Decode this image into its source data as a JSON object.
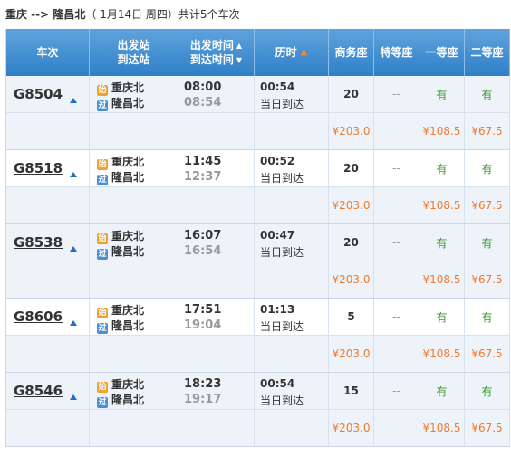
{
  "title": {
    "route": "重庆 --> 隆昌北",
    "date": "（ 1月14日  周四）",
    "count": "共计5个车次"
  },
  "headers": {
    "train": "车次",
    "station_top": "出发站",
    "station_bottom": "到达站",
    "time_top": "出发时间",
    "time_bottom": "到达时间",
    "duration": "历时",
    "business": "商务座",
    "special": "特等座",
    "first": "一等座",
    "second": "二等座"
  },
  "badges": {
    "start": "始",
    "pass": "过"
  },
  "trains": [
    {
      "no": "G8504",
      "from": "重庆北",
      "to": "隆昌北",
      "dep": "08:00",
      "arr": "08:54",
      "dur": "00:54",
      "arrive_day": "当日到达",
      "business": "20",
      "special": "--",
      "first": "有",
      "second": "有",
      "price_business": "¥203.0",
      "price_first": "¥108.5",
      "price_second": "¥67.5"
    },
    {
      "no": "G8518",
      "from": "重庆北",
      "to": "隆昌北",
      "dep": "11:45",
      "arr": "12:37",
      "dur": "00:52",
      "arrive_day": "当日到达",
      "business": "20",
      "special": "--",
      "first": "有",
      "second": "有",
      "price_business": "¥203.0",
      "price_first": "¥108.5",
      "price_second": "¥67.5"
    },
    {
      "no": "G8538",
      "from": "重庆北",
      "to": "隆昌北",
      "dep": "16:07",
      "arr": "16:54",
      "dur": "00:47",
      "arrive_day": "当日到达",
      "business": "20",
      "special": "--",
      "first": "有",
      "second": "有",
      "price_business": "¥203.0",
      "price_first": "¥108.5",
      "price_second": "¥67.5"
    },
    {
      "no": "G8606",
      "from": "重庆北",
      "to": "隆昌北",
      "dep": "17:51",
      "arr": "19:04",
      "dur": "01:13",
      "arrive_day": "当日到达",
      "business": "5",
      "special": "--",
      "first": "有",
      "second": "有",
      "price_business": "¥203.0",
      "price_first": "¥108.5",
      "price_second": "¥67.5"
    },
    {
      "no": "G8546",
      "from": "重庆北",
      "to": "隆昌北",
      "dep": "18:23",
      "arr": "19:17",
      "dur": "00:54",
      "arrive_day": "当日到达",
      "business": "15",
      "special": "--",
      "first": "有",
      "second": "有",
      "price_business": "¥203.0",
      "price_first": "¥108.5",
      "price_second": "¥67.5"
    }
  ],
  "colors": {
    "header_top": "#5fa3dd",
    "header_bottom": "#2f7fc8",
    "price": "#f07a2c",
    "available": "#3a9a2a",
    "row_alt": "#eef3fa"
  }
}
